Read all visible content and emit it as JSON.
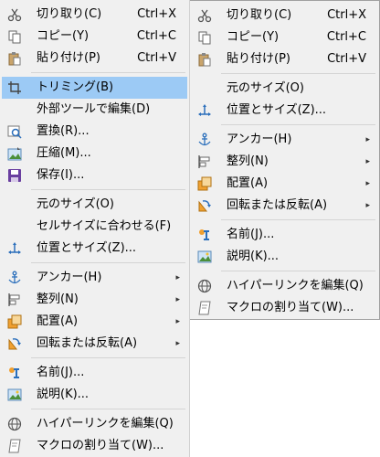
{
  "left_menu": {
    "items": [
      {
        "label": "切り取り(C)",
        "shortcut": "Ctrl+X",
        "icon": "scissors-icon"
      },
      {
        "label": "コピー(Y)",
        "shortcut": "Ctrl+C",
        "icon": "copy-icon"
      },
      {
        "label": "貼り付け(P)",
        "shortcut": "Ctrl+V",
        "icon": "paste-icon"
      },
      {
        "label": "トリミング(B)",
        "icon": "crop-icon"
      },
      {
        "label": "外部ツールで編集(D)"
      },
      {
        "label": "置換(R)...",
        "icon": "replace-image-icon"
      },
      {
        "label": "圧縮(M)...",
        "icon": "compress-image-icon"
      },
      {
        "label": "保存(I)...",
        "icon": "save-icon"
      },
      {
        "label": "元のサイズ(O)"
      },
      {
        "label": "セルサイズに合わせる(F)"
      },
      {
        "label": "位置とサイズ(Z)...",
        "icon": "position-size-icon"
      },
      {
        "label": "アンカー(H)",
        "icon": "anchor-icon"
      },
      {
        "label": "整列(N)",
        "icon": "align-icon"
      },
      {
        "label": "配置(A)",
        "icon": "arrange-icon"
      },
      {
        "label": "回転または反転(A)",
        "icon": "rotate-icon"
      },
      {
        "label": "名前(J)...",
        "icon": "name-icon"
      },
      {
        "label": "説明(K)...",
        "icon": "description-icon"
      },
      {
        "label": "ハイパーリンクを編集(Q)",
        "icon": "hyperlink-icon"
      },
      {
        "label": "マクロの割り当て(W)...",
        "icon": "macro-icon"
      }
    ]
  },
  "right_menu": {
    "items": [
      {
        "label": "切り取り(C)",
        "shortcut": "Ctrl+X",
        "icon": "scissors-icon"
      },
      {
        "label": "コピー(Y)",
        "shortcut": "Ctrl+C",
        "icon": "copy-icon"
      },
      {
        "label": "貼り付け(P)",
        "shortcut": "Ctrl+V",
        "icon": "paste-icon"
      },
      {
        "label": "元のサイズ(O)"
      },
      {
        "label": "位置とサイズ(Z)...",
        "icon": "position-size-icon"
      },
      {
        "label": "アンカー(H)",
        "icon": "anchor-icon"
      },
      {
        "label": "整列(N)",
        "icon": "align-icon"
      },
      {
        "label": "配置(A)",
        "icon": "arrange-icon"
      },
      {
        "label": "回転または反転(A)",
        "icon": "rotate-icon"
      },
      {
        "label": "名前(J)...",
        "icon": "name-icon"
      },
      {
        "label": "説明(K)...",
        "icon": "description-icon"
      },
      {
        "label": "ハイパーリンクを編集(Q)",
        "icon": "hyperlink-icon"
      },
      {
        "label": "マクロの割り当て(W)...",
        "icon": "macro-icon"
      }
    ]
  },
  "submenu_arrow": "▸",
  "colors": {
    "menu_bg": "#f0f0f0",
    "highlight": "#9ccaf5",
    "separator": "#d4d4d4"
  }
}
